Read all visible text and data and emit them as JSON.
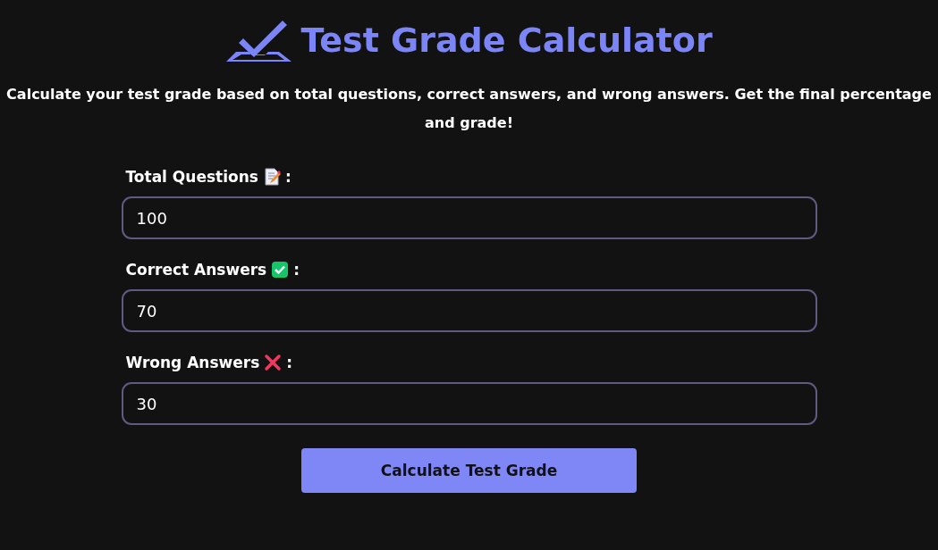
{
  "title": "Test Grade Calculator",
  "description": "Calculate your test grade based on total questions, correct answers, and wrong answers. Get the final percentage and grade!",
  "fields": [
    {
      "label": "Total Questions",
      "kind": "memo",
      "suffix": ":",
      "value": "100"
    },
    {
      "label": "Correct Answers",
      "kind": "check",
      "suffix": ":",
      "value": "70"
    },
    {
      "label": "Wrong Answers",
      "kind": "cross",
      "suffix": ":",
      "value": "30"
    }
  ],
  "button": "Calculate Test Grade"
}
